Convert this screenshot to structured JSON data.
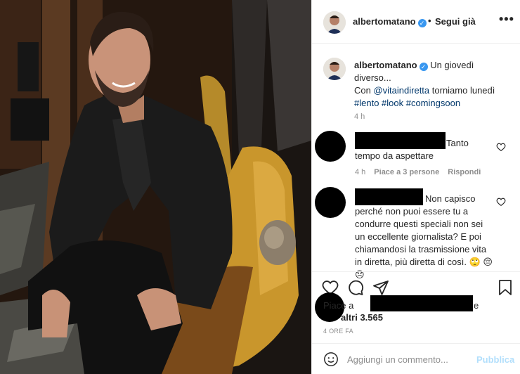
{
  "post": {
    "username": "albertomatano",
    "verified_mark": "✓",
    "dot": "•",
    "follow_label": "Segui già",
    "more_label": "•••"
  },
  "caption": {
    "username": "albertomatano",
    "line1": "Un giovedì diverso...",
    "line2_prefix": "Con ",
    "mention": "@vitaindiretta",
    "line2_suffix": " torniamo lunedì",
    "hashtags": "#lento #look #comingsoon",
    "time": "4 h"
  },
  "comments": [
    {
      "text": "Tanto tempo da aspettare",
      "time": "4 h",
      "likes": "Piace a 3 persone",
      "reply": "Rispondi"
    },
    {
      "text": "Non capisco perché non puoi essere tu a condurre questi speciali non sei un eccellente giornalista? E poi chiamandosi la trasmissione vita in diretta, più diretta di così. 🙄 😔😞"
    }
  ],
  "likes": {
    "prefix": "Piace a",
    "suffix": "e",
    "others": "altri 3.565"
  },
  "timestamp": "4 ORE FA",
  "add_comment": {
    "placeholder": "Aggiungi un commento...",
    "post_label": "Pubblica"
  },
  "colors": {
    "verified": "#3897f0",
    "link": "#00376b",
    "muted": "#8e8e8e",
    "publish_disabled": "#b2dffc"
  },
  "icons": [
    "heart-icon",
    "comment-icon",
    "share-icon",
    "bookmark-icon",
    "smile-icon",
    "more-icon"
  ]
}
